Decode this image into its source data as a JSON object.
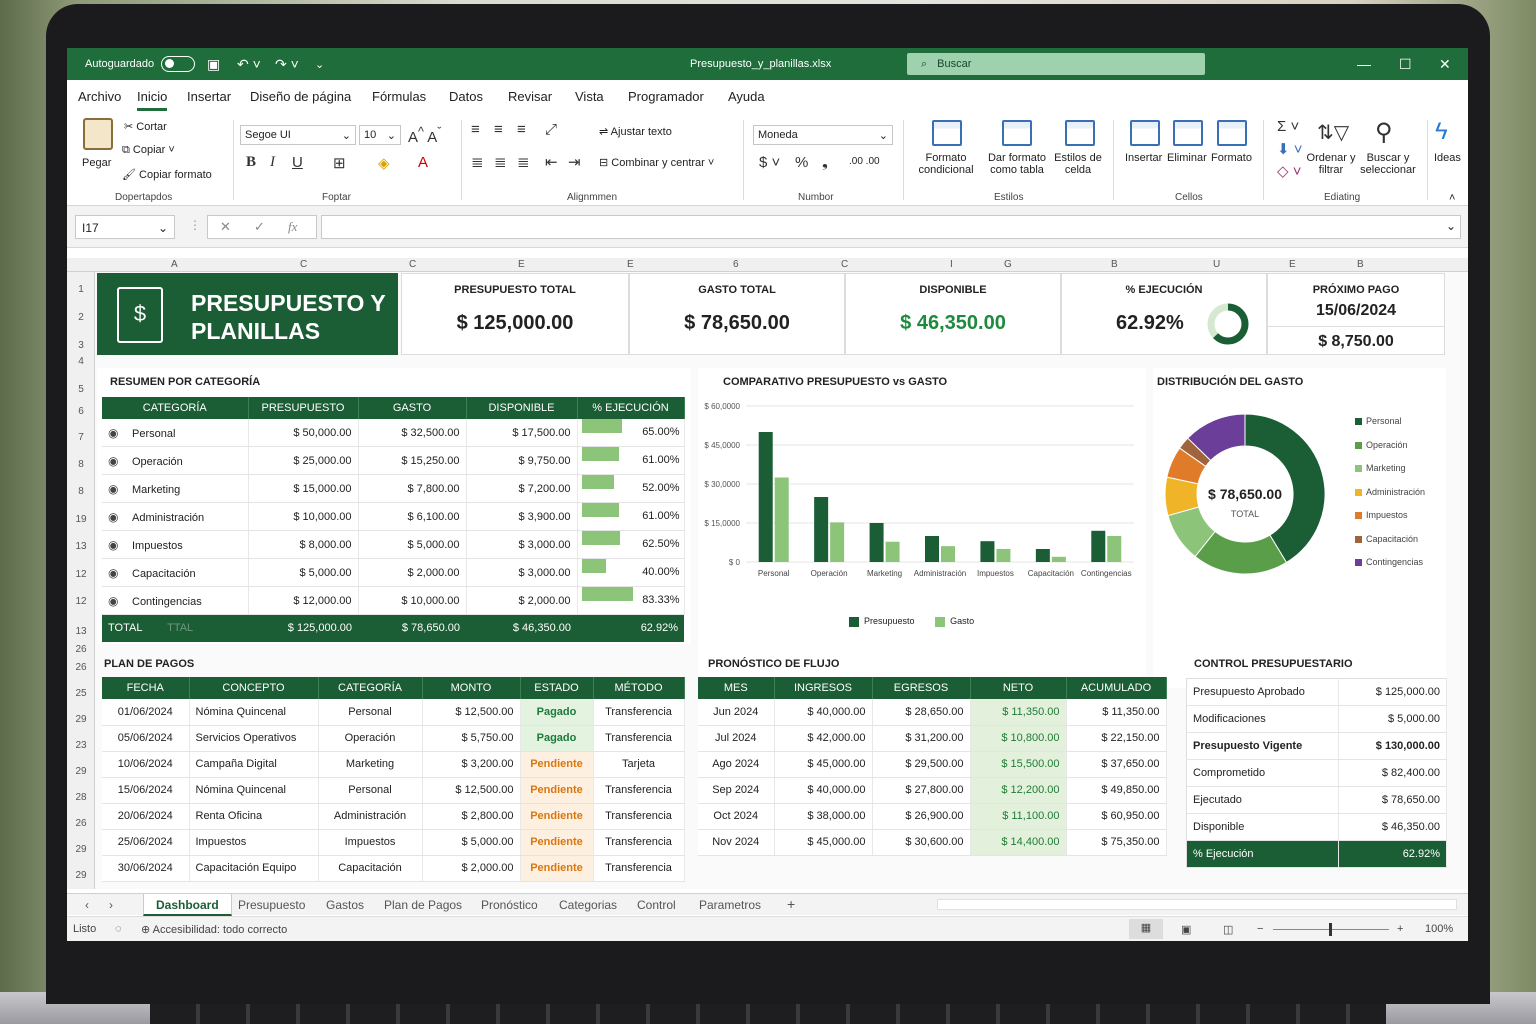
{
  "window": {
    "autosave": "Autoguardado",
    "filename": "Presupuesto_y_planillas.xlsx",
    "search": "Buscar"
  },
  "menu": [
    "Archivo",
    "Inicio",
    "Insertar",
    "Diseño de página",
    "Fórmulas",
    "Datos",
    "Revisar",
    "Vista",
    "Programador",
    "Ayuda"
  ],
  "ribbon": {
    "paste": "Pegar",
    "cut": "Cortar",
    "copy": "Copiar",
    "format_painter": "Copiar formato",
    "g_clip": "Dopertapdos",
    "font": "Segoe UI",
    "size": "10",
    "g_font": "Foptar",
    "wrap": "Ajustar texto",
    "merge": "Combinar y centrar",
    "g_align": "Alignmmen",
    "number_format": "Moneda",
    "g_number": "Numbor",
    "cond": [
      "Formato",
      "condicional"
    ],
    "astable": [
      "Dar formato",
      "como tabla"
    ],
    "cellstyles": [
      "Estilos de",
      "celda"
    ],
    "g_styles": "Estilos",
    "insert": "Insertar",
    "delete": "Eliminar",
    "format": "Formato",
    "g_cells": "Cellos",
    "sort": [
      "Ordenar y",
      "filtrar"
    ],
    "find": [
      "Buscar y",
      "seleccionar"
    ],
    "g_edit": "Ediating",
    "ideas": "Ideas"
  },
  "namebox": "I17",
  "columns": [
    "A",
    "C",
    "C",
    "E",
    "E",
    "6",
    "C",
    "I",
    "G",
    "B",
    "U",
    "E",
    "B"
  ],
  "rows": [
    "1",
    "2",
    "3",
    "4",
    "5",
    "6",
    "7",
    "8",
    "8",
    "19",
    "13",
    "12",
    "12",
    "13",
    "26",
    "26",
    "25",
    "29",
    "23",
    "29",
    "28",
    "26",
    "29",
    "29"
  ],
  "dashboard": {
    "title": [
      "PRESUPUESTO Y",
      "PLANILLAS"
    ],
    "kpis": {
      "budget_label": "PRESUPUESTO TOTAL",
      "budget": "$ 125,000.00",
      "spent_label": "GASTO TOTAL",
      "spent": "$ 78,650.00",
      "available_label": "DISPONIBLE",
      "available": "$ 46,350.00",
      "exec_label": "% EJECUCIÓN",
      "exec": "62.92%",
      "exec_fraction": 0.6292,
      "next_label": "PRÓXIMO PAGO",
      "next_date": "15/06/2024",
      "next_amount": "$ 8,750.00"
    },
    "summary": {
      "title": "RESUMEN POR CATEGORÍA",
      "headers": [
        "CATEGORÍA",
        "PRESUPUESTO",
        "GASTO",
        "DISPONIBLE",
        "% EJECUCIÓN"
      ],
      "rows": [
        {
          "icon": "people-icon",
          "cat": "Personal",
          "budget": "$ 50,000.00",
          "spent": "$ 32,500.00",
          "avail": "$ 17,500.00",
          "pct": "65.00%",
          "p": 65
        },
        {
          "icon": "briefcase-icon",
          "cat": "Operación",
          "budget": "$ 25,000.00",
          "spent": "$ 15,250.00",
          "avail": "$ 9,750.00",
          "pct": "61.00%",
          "p": 61
        },
        {
          "icon": "megaphone-icon",
          "cat": "Marketing",
          "budget": "$ 15,000.00",
          "spent": "$ 7,800.00",
          "avail": "$ 7,200.00",
          "pct": "52.00%",
          "p": 52
        },
        {
          "icon": "building-icon",
          "cat": "Administración",
          "budget": "$ 10,000.00",
          "spent": "$ 6,100.00",
          "avail": "$ 3,900.00",
          "pct": "61.00%",
          "p": 61
        },
        {
          "icon": "receipt-icon",
          "cat": "Impuestos",
          "budget": "$ 8,000.00",
          "spent": "$ 5,000.00",
          "avail": "$ 3,000.00",
          "pct": "62.50%",
          "p": 62.5
        },
        {
          "icon": "teacher-icon",
          "cat": "Capacitación",
          "budget": "$ 5,000.00",
          "spent": "$ 2,000.00",
          "avail": "$ 3,000.00",
          "pct": "40.00%",
          "p": 40
        },
        {
          "icon": "shield-icon",
          "cat": "Contingencias",
          "budget": "$ 12,000.00",
          "spent": "$ 10,000.00",
          "avail": "$ 2,000.00",
          "pct": "83.33%",
          "p": 83.33
        }
      ],
      "total": {
        "label": "TOTAL",
        "faded": "TTAL",
        "budget": "$ 125,000.00",
        "spent": "$ 78,650.00",
        "avail": "$ 46,350.00",
        "pct": "62.92%"
      }
    },
    "payments": {
      "title": "PLAN DE PAGOS",
      "headers": [
        "FECHA",
        "CONCEPTO",
        "CATEGORÍA",
        "MONTO",
        "ESTADO",
        "MÉTODO"
      ],
      "rows": [
        [
          "01/06/2024",
          "Nómina Quincenal",
          "Personal",
          "$ 12,500.00",
          "Pagado",
          "Transferencia"
        ],
        [
          "05/06/2024",
          "Servicios Operativos",
          "Operación",
          "$ 5,750.00",
          "Pagado",
          "Transferencia"
        ],
        [
          "10/06/2024",
          "Campaña Digital",
          "Marketing",
          "$ 3,200.00",
          "Pendiente",
          "Tarjeta"
        ],
        [
          "15/06/2024",
          "Nómina Quincenal",
          "Personal",
          "$ 12,500.00",
          "Pendiente",
          "Transferencia"
        ],
        [
          "20/06/2024",
          "Renta Oficina",
          "Administración",
          "$ 2,800.00",
          "Pendiente",
          "Transferencia"
        ],
        [
          "25/06/2024",
          "Impuestos",
          "Impuestos",
          "$ 5,000.00",
          "Pendiente",
          "Transferencia"
        ],
        [
          "30/06/2024",
          "Capacitación Equipo",
          "Capacitación",
          "$ 2,000.00",
          "Pendiente",
          "Transferencia"
        ]
      ]
    },
    "forecast": {
      "title": "PRONÓSTICO DE FLUJO",
      "headers": [
        "MES",
        "INGRESOS",
        "EGRESOS",
        "NETO",
        "ACUMULADO"
      ],
      "rows": [
        [
          "Jun 2024",
          "$ 40,000.00",
          "$ 28,650.00",
          "$ 11,350.00",
          "$ 11,350.00"
        ],
        [
          "Jul 2024",
          "$ 42,000.00",
          "$ 31,200.00",
          "$ 10,800.00",
          "$ 22,150.00"
        ],
        [
          "Ago 2024",
          "$ 45,000.00",
          "$ 29,500.00",
          "$ 15,500.00",
          "$ 37,650.00"
        ],
        [
          "Sep 2024",
          "$ 40,000.00",
          "$ 27,800.00",
          "$ 12,200.00",
          "$ 49,850.00"
        ],
        [
          "Oct 2024",
          "$ 38,000.00",
          "$ 26,900.00",
          "$ 11,100.00",
          "$ 60,950.00"
        ],
        [
          "Nov 2024",
          "$ 45,000.00",
          "$ 30,600.00",
          "$ 14,400.00",
          "$ 75,350.00"
        ]
      ]
    },
    "control": {
      "title": "CONTROL PRESUPUESTARIO",
      "rows": [
        [
          "Presupuesto Aprobado",
          "$ 125,000.00"
        ],
        [
          "Modificaciones",
          "$ 5,000.00"
        ],
        [
          "Presupuesto Vigente",
          "$ 130,000.00"
        ],
        [
          "Comprometido",
          "$ 82,400.00"
        ],
        [
          "Ejecutado",
          "$ 78,650.00"
        ],
        [
          "Disponible",
          "$ 46,350.00"
        ],
        [
          "% Ejecución",
          "62.92%"
        ]
      ]
    }
  },
  "chart_data": [
    {
      "type": "bar",
      "title": "COMPARATIVO PRESUPUESTO vs GASTO",
      "categories": [
        "Personal",
        "Operación",
        "Marketing",
        "Administración",
        "Impuestos",
        "Capacitación",
        "Contingencias"
      ],
      "series": [
        {
          "name": "Presupuesto",
          "color": "#1b5e35",
          "values": [
            50000,
            25000,
            15000,
            10000,
            8000,
            5000,
            12000
          ]
        },
        {
          "name": "Gasto",
          "color": "#8cc47a",
          "values": [
            32500,
            15250,
            7800,
            6100,
            5000,
            2000,
            10000
          ]
        }
      ],
      "yticks": [
        "$ 60,0000",
        "$ 45,0000",
        "$ 30,0000",
        "$ 15,0000",
        "$ 0"
      ],
      "ylim": [
        0,
        60000
      ],
      "legend": "bottom",
      "grid": true
    },
    {
      "type": "pie",
      "title": "DISTRIBUCIÓN DEL GASTO",
      "center_value": "$ 78,650.00",
      "center_label": "TOTAL",
      "labels": [
        "Personal",
        "Operación",
        "Marketing",
        "Administración",
        "Impuestos",
        "Capacitación",
        "Contingencias"
      ],
      "values": [
        32500,
        15250,
        7800,
        6100,
        5000,
        2000,
        10000
      ],
      "colors": [
        "#1b5e35",
        "#5a9e4a",
        "#8cc47a",
        "#f0b429",
        "#e07b2a",
        "#a0643c",
        "#6b3f99"
      ],
      "legend": "right"
    }
  ],
  "sheets": [
    "Dashboard",
    "Presupuesto",
    "Gastos",
    "Plan de Pagos",
    "Pronóstico",
    "Categorias",
    "Control",
    "Parametros"
  ],
  "status": {
    "ready": "Listo",
    "accessibility": "Accesibilidad: todo correcto",
    "zoom": "100%"
  }
}
